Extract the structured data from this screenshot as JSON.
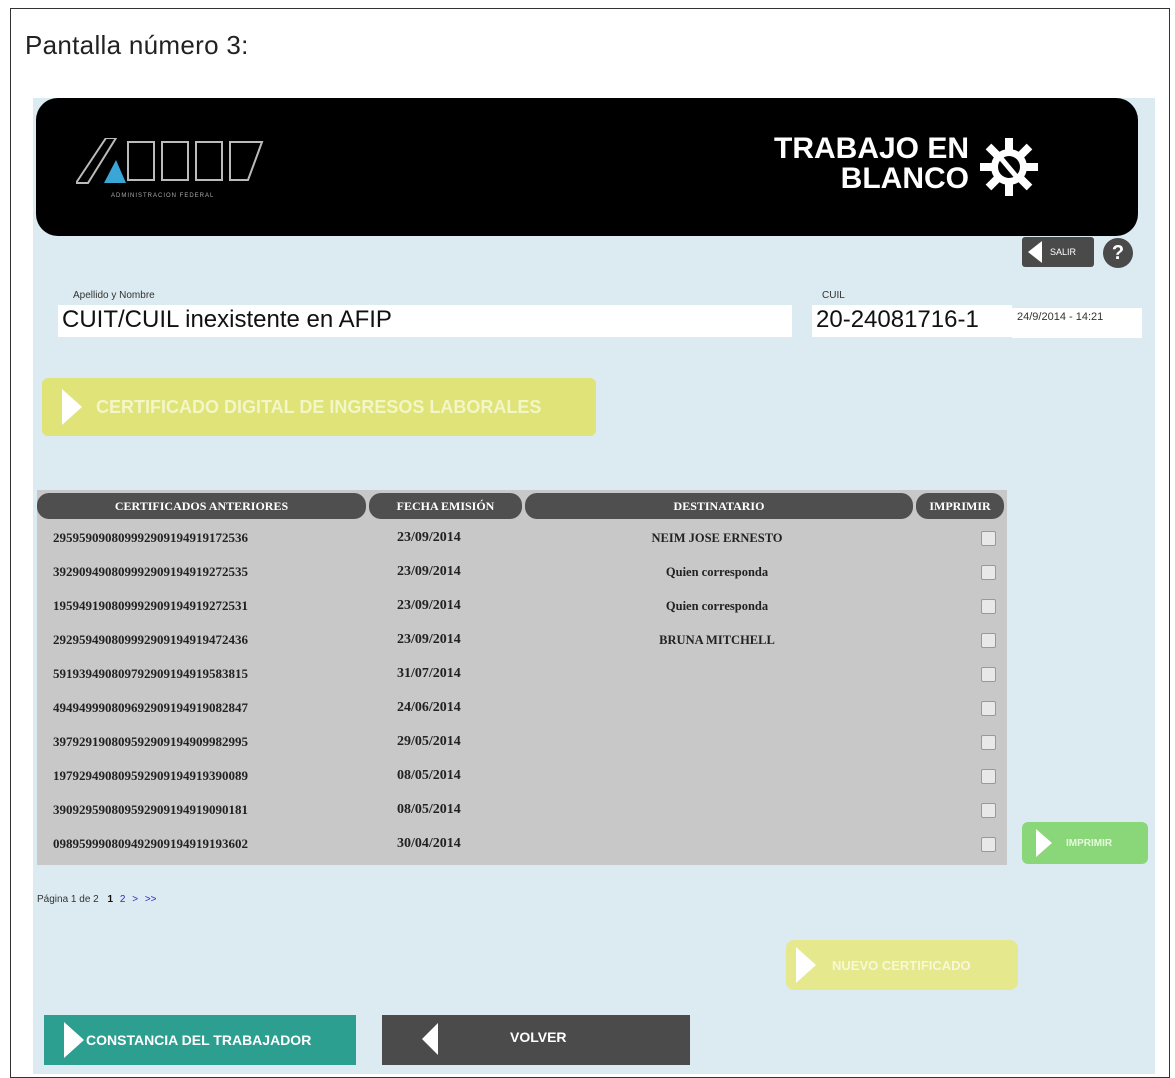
{
  "page_title": "Pantalla número 3:",
  "header": {
    "brand_line1": "TRABAJO EN",
    "brand_line2": "BLANCO",
    "logo_sub": "ADMINISTRACION FEDERAL"
  },
  "top_actions": {
    "salir_label": "SALIR",
    "help_label": "?"
  },
  "person": {
    "name_label": "Apellido y Nombre",
    "name_value": "CUIT/CUIL inexistente en AFIP",
    "cuil_label": "CUIL",
    "cuil_value": "20-24081716-1",
    "datetime": "24/9/2014 - 14:21"
  },
  "cert_button_label": "CERTIFICADO DIGITAL DE INGRESOS LABORALES",
  "table": {
    "headers": [
      "CERTIFICADOS ANTERIORES",
      "FECHA EMISIÓN",
      "DESTINATARIO",
      "IMPRIMIR"
    ],
    "rows": [
      {
        "id": "295959090809992909194919172536",
        "date": "23/09/2014",
        "dest": "NEIM JOSE ERNESTO"
      },
      {
        "id": "392909490809992909194919272535",
        "date": "23/09/2014",
        "dest": "Quien corresponda"
      },
      {
        "id": "195949190809992909194919272531",
        "date": "23/09/2014",
        "dest": "Quien corresponda"
      },
      {
        "id": "292959490809992909194919472436",
        "date": "23/09/2014",
        "dest": "BRUNA MITCHELL"
      },
      {
        "id": "591939490809792909194919583815",
        "date": "31/07/2014",
        "dest": ""
      },
      {
        "id": "494949990809692909194919082847",
        "date": "24/06/2014",
        "dest": ""
      },
      {
        "id": "397929190809592909194909982995",
        "date": "29/05/2014",
        "dest": ""
      },
      {
        "id": "197929490809592909194919390089",
        "date": "08/05/2014",
        "dest": ""
      },
      {
        "id": "390929590809592909194919090181",
        "date": "08/05/2014",
        "dest": ""
      },
      {
        "id": "098959990809492909194919193602",
        "date": "30/04/2014",
        "dest": ""
      }
    ]
  },
  "imprimir_label": "IMPRIMIR",
  "pager": {
    "text": "Página 1 de 2",
    "current": "1",
    "next_page": "2",
    "next": ">",
    "last": ">>"
  },
  "nuevo_label": "NUEVO CERTIFICADO",
  "constancia_label": "CONSTANCIA DEL TRABAJADOR",
  "volver_label": "VOLVER",
  "colors": {
    "app_bg": "#dcebf1",
    "cert_button": "#dfe378",
    "imprimir_button": "#8ad77a",
    "constancia_button": "#2d9f90",
    "volver_button": "#4b4b4b"
  }
}
